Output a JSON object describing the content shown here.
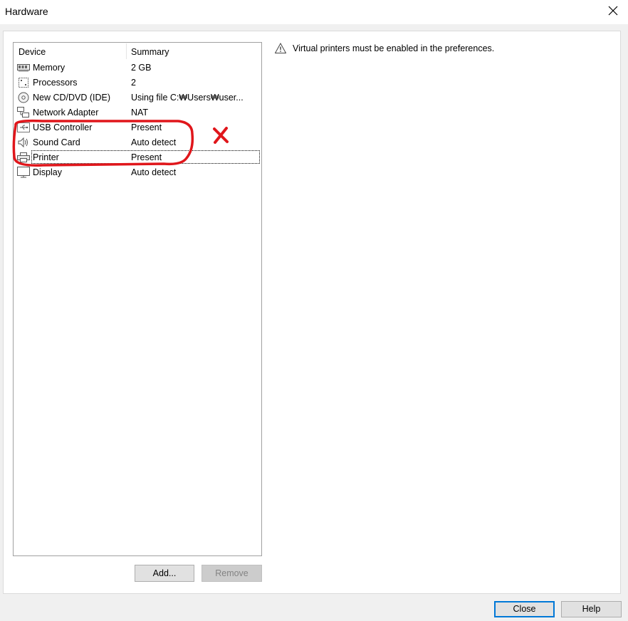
{
  "window": {
    "title": "Hardware"
  },
  "device_list": {
    "columns": {
      "device": "Device",
      "summary": "Summary"
    },
    "rows": [
      {
        "name": "Memory",
        "summary": "2 GB",
        "icon": "memory-icon"
      },
      {
        "name": "Processors",
        "summary": "2",
        "icon": "processor-icon"
      },
      {
        "name": "New CD/DVD (IDE)",
        "summary": "Using file C:₩Users₩user...",
        "icon": "cd-dvd-icon"
      },
      {
        "name": "Network Adapter",
        "summary": "NAT",
        "icon": "network-adapter-icon"
      },
      {
        "name": "USB Controller",
        "summary": "Present",
        "icon": "usb-icon"
      },
      {
        "name": "Sound Card",
        "summary": "Auto detect",
        "icon": "speaker-icon"
      },
      {
        "name": "Printer",
        "summary": "Present",
        "icon": "printer-icon",
        "selected": true
      },
      {
        "name": "Display",
        "summary": "Auto detect",
        "icon": "monitor-icon"
      }
    ]
  },
  "buttons": {
    "add": "Add...",
    "remove": "Remove",
    "close": "Close",
    "help": "Help"
  },
  "warning": {
    "text": "Virtual printers must be enabled in the preferences.",
    "icon": "warning-icon"
  },
  "annotation": {
    "color": "#e0161b",
    "mark": "X"
  }
}
